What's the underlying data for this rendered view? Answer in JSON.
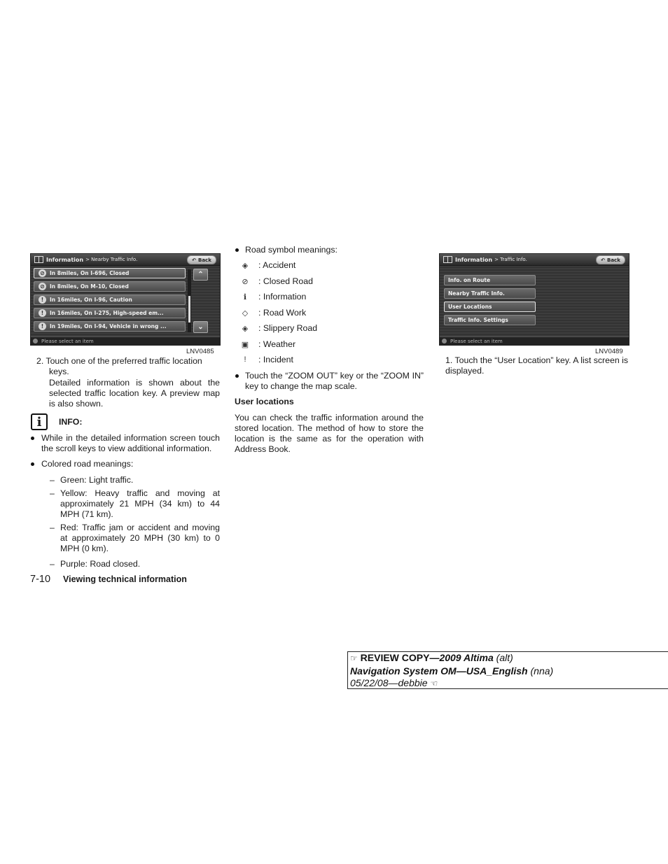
{
  "figures": {
    "left": {
      "header_title": "Information",
      "header_crumb": "> Nearby Traffic Info.",
      "back_label": "Back",
      "items": [
        {
          "label": "In 8miles, On I-696, Closed",
          "icon": "closed-road-icon",
          "glyph": "⊘"
        },
        {
          "label": "In 8miles, On M-10, Closed",
          "icon": "closed-road-icon",
          "glyph": "⊘"
        },
        {
          "label": "In 16miles, On I-96, Caution",
          "icon": "incident-icon",
          "glyph": "!"
        },
        {
          "label": "In 16miles, On I-275, High-speed em...",
          "icon": "incident-icon",
          "glyph": "!"
        },
        {
          "label": "In 19miles, On I-94, Vehicle in wrong ...",
          "icon": "incident-icon",
          "glyph": "!"
        }
      ],
      "scroll_up": "⌃",
      "scroll_down": "⌄",
      "footer": "Please select an item",
      "label": "LNV0485"
    },
    "right": {
      "header_title": "Information",
      "header_crumb": "> Traffic Info.",
      "back_label": "Back",
      "items": [
        {
          "label": "Info. on Route"
        },
        {
          "label": "Nearby Traffic Info."
        },
        {
          "label": "User Locations"
        },
        {
          "label": "Traffic Info. Settings"
        }
      ],
      "footer": "Please select an item",
      "label": "LNV0489"
    }
  },
  "col1": {
    "step2_line1": "2.  Touch one of the preferred traffic location",
    "step2_line2": "keys.",
    "step2_detail": "Detailed information is shown about the selected traffic location key. A preview map is also shown.",
    "info_heading": "INFO:",
    "bullet1": "While in the detailed information screen touch the scroll keys to view additional information.",
    "bullet2": "Colored road meanings:",
    "colors": [
      "Green: Light traffic.",
      "Yellow: Heavy traffic and moving at approximately 21 MPH (34 km) to 44 MPH (71 km).",
      "Red: Traffic jam or accident and moving at approximately 20 MPH (30 km) to 0 MPH (0 km).",
      "Purple: Road closed."
    ],
    "dash": "–"
  },
  "col2": {
    "bullet_symbols": "Road symbol meanings:",
    "symbols": [
      {
        "name": "accident-icon",
        "glyph": "◈",
        "label": ": Accident"
      },
      {
        "name": "closed-road-icon",
        "glyph": "⊘",
        "label": ": Closed Road"
      },
      {
        "name": "information-icon",
        "glyph": "ℹ",
        "label": ": Information"
      },
      {
        "name": "road-work-icon",
        "glyph": "◇",
        "label": ": Road Work"
      },
      {
        "name": "slippery-road-icon",
        "glyph": "◈",
        "label": ": Slippery Road"
      },
      {
        "name": "weather-icon",
        "glyph": "▣",
        "label": ": Weather"
      },
      {
        "name": "incident-icon",
        "glyph": "!",
        "label": ": Incident"
      }
    ],
    "bullet_zoom": "Touch the “ZOOM OUT” key or the “ZOOM IN” key to change the map scale.",
    "heading": "User locations",
    "paragraph": "You can check the traffic information around the stored location. The method of how to store the location is the same as for the operation with Address Book."
  },
  "col3": {
    "step1": "1.  Touch the “User Location” key. A list screen is displayed."
  },
  "footer": {
    "page_number": "7-10",
    "section": "Viewing technical information"
  },
  "review": {
    "line1_bold": "REVIEW COPY—",
    "line1_italic_bold": "2009 Altima",
    "line1_italic": " (alt)",
    "line2_bold": "Navigation System OM—USA_English",
    "line2_italic": " (nna)",
    "line3": "05/22/08—debbie",
    "hand_right": "☞",
    "hand_left": "☜"
  }
}
